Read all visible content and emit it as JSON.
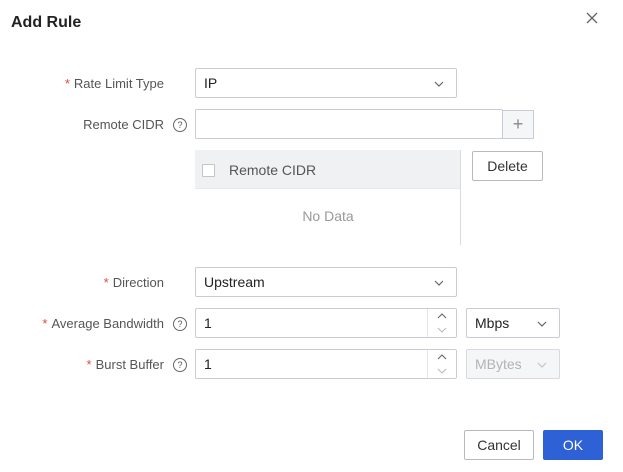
{
  "dialog": {
    "title": "Add Rule",
    "close_icon": "close-icon"
  },
  "form": {
    "rate_limit_type": {
      "label": "Rate Limit Type",
      "required": true,
      "value": "IP"
    },
    "remote_cidr": {
      "label": "Remote CIDR",
      "value": "",
      "add_icon": "plus-icon"
    },
    "cidr_table": {
      "column": "Remote CIDR",
      "empty_text": "No Data",
      "delete_label": "Delete"
    },
    "direction": {
      "label": "Direction",
      "required": true,
      "value": "Upstream"
    },
    "average_bandwidth": {
      "label": "Average Bandwidth",
      "required": true,
      "value": "1",
      "unit": "Mbps"
    },
    "burst_buffer": {
      "label": "Burst Buffer",
      "required": true,
      "value": "1",
      "unit": "MBytes",
      "unit_disabled": true
    }
  },
  "footer": {
    "cancel_label": "Cancel",
    "ok_label": "OK"
  },
  "colors": {
    "primary": "#2e60d6",
    "required": "#e8463a",
    "border": "#c9ccd2"
  }
}
